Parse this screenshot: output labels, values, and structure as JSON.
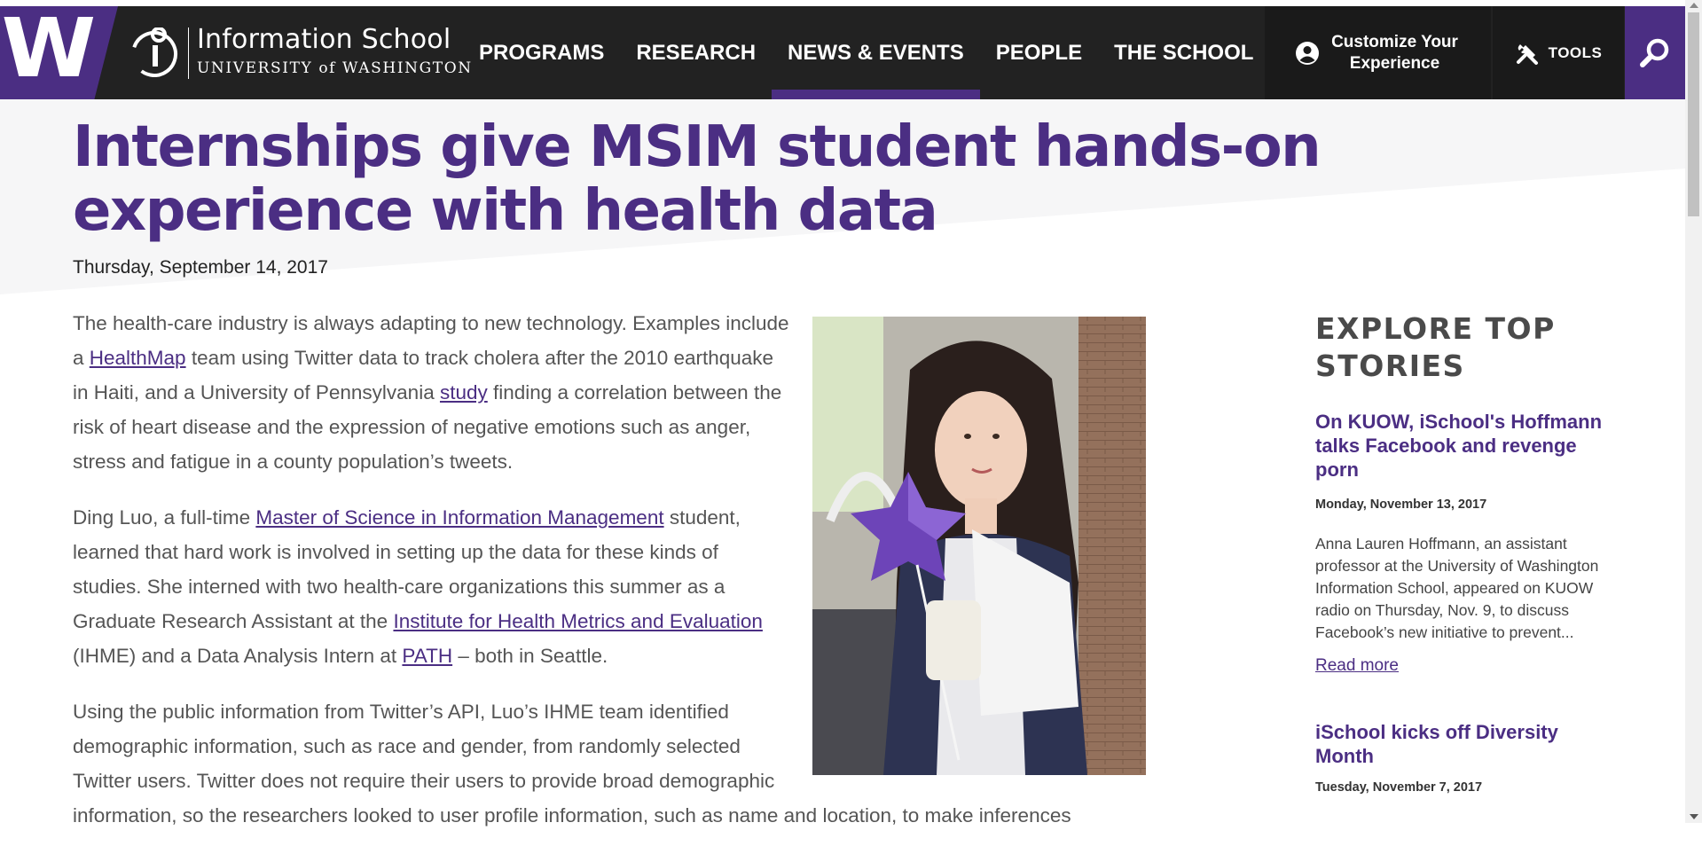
{
  "header": {
    "uw_logo_letter": "W",
    "school_name": "Information School",
    "university_line": "UNIVERSITY of WASHINGTON",
    "nav": [
      {
        "label": "PROGRAMS",
        "active": false
      },
      {
        "label": "RESEARCH",
        "active": false
      },
      {
        "label": "NEWS & EVENTS",
        "active": true
      },
      {
        "label": "PEOPLE",
        "active": false
      },
      {
        "label": "THE SCHOOL",
        "active": false
      }
    ],
    "customize_label": "Customize Your Experience",
    "tools_label": "TOOLS",
    "colors": {
      "brand_purple": "#4b2e83",
      "nav_bg": "#222222"
    }
  },
  "article": {
    "title": "Internships give MSIM student hands-on experience with health data",
    "date": "Thursday, September 14, 2017",
    "p1": {
      "t1": "The health-care industry is always adapting to new technology. Examples include a ",
      "link1": "HealthMap",
      "t2": " team using Twitter data to track cholera after the 2010 earthquake in Haiti, and a University of Pennsylvania ",
      "link2": "study",
      "t3": " finding a correlation between the risk of heart disease and the expression of negative emotions such as anger, stress and fatigue in a county population’s tweets."
    },
    "p2": {
      "t1": "Ding Luo, a full-time ",
      "link1": "Master of Science in Information Management",
      "t2": " student, learned that hard work is involved in setting up the data for these kinds of studies. She interned with two health-care organizations this summer as a Graduate Research Assistant at the ",
      "link2": "Institute for Health Metrics and Evaluation",
      "t3": " (IHME) and a Data Analysis Intern at ",
      "link3": "PATH",
      "t4": " – both in Seattle."
    },
    "p3": "Using the public information from Twitter’s API, Luo’s IHME team identified demographic information, such as race and gender, from randomly selected Twitter users. Twitter does not require their users to provide broad demographic information, so the researchers looked to user profile information, such as name and location, to make inferences"
  },
  "sidebar": {
    "heading": "EXPLORE TOP STORIES",
    "stories": [
      {
        "title": "On KUOW, iSchool's Hoffmann talks Facebook and revenge porn",
        "date": "Monday, November 13, 2017",
        "excerpt": "Anna Lauren Hoffmann, an assistant professor at the University of Washington Information School, appeared on KUOW radio on Thursday, Nov. 9, to discuss Facebook’s new initiative to prevent...",
        "read_more": "Read more"
      },
      {
        "title": "iSchool kicks off Diversity Month",
        "date": "Tuesday, November 7, 2017"
      }
    ]
  }
}
